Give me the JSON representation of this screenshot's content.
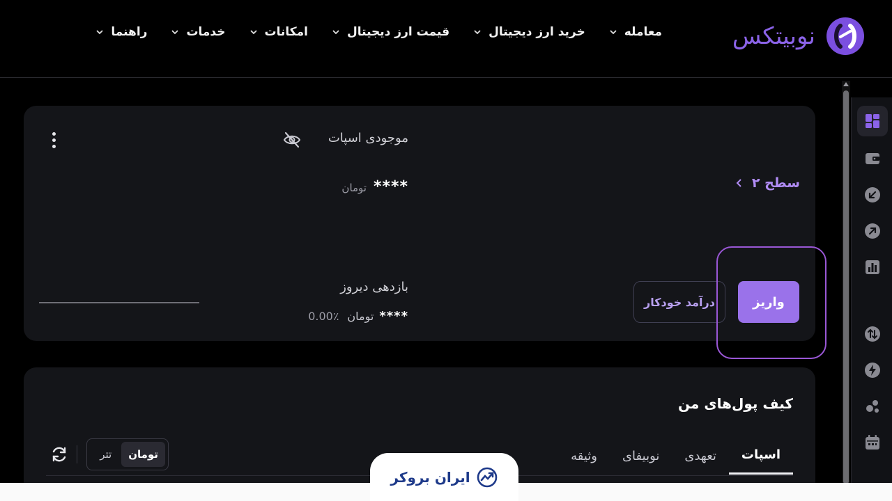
{
  "header": {
    "logo_text": "نوبیتکس",
    "nav": [
      {
        "label": "معامله"
      },
      {
        "label": "خرید ارز دیجیتال"
      },
      {
        "label": "قیمت ارز دیجیتال"
      },
      {
        "label": "امکانات"
      },
      {
        "label": "خدمات"
      },
      {
        "label": "راهنما"
      }
    ]
  },
  "sidebar": {
    "items": [
      {
        "icon": "dashboard-icon",
        "active": true
      },
      {
        "icon": "wallet-icon"
      },
      {
        "icon": "deposit-arrow-icon"
      },
      {
        "icon": "withdraw-arrow-icon"
      },
      {
        "icon": "chart-icon"
      },
      {
        "icon": "exchange-icon"
      },
      {
        "icon": "lightning-icon"
      },
      {
        "icon": "coins-icon"
      },
      {
        "icon": "calendar-icon"
      }
    ]
  },
  "balance": {
    "title": "موجودی اسپات",
    "amount": "****",
    "unit": "تومان",
    "level": "سطح ۲",
    "yield_title": "بازدهی دیروز",
    "yield_amount": "****",
    "yield_unit": "تومان",
    "yield_percent": "0.00٪",
    "auto_income_label": "درآمد خودکار",
    "deposit_label": "واریز"
  },
  "wallets": {
    "title": "کیف پول‌های من",
    "tabs": [
      {
        "label": "اسپات",
        "active": true
      },
      {
        "label": "تعهدی"
      },
      {
        "label": "نوبیفای"
      },
      {
        "label": "وثیقه"
      }
    ],
    "currency": {
      "options": [
        "تومان",
        "تتر"
      ],
      "selected": "تومان"
    }
  },
  "watermark": {
    "text": "ایران بروکر"
  },
  "colors": {
    "accent": "#9a72ea",
    "highlight": "#9a57d6",
    "background": "#000000",
    "card": "#141519"
  }
}
